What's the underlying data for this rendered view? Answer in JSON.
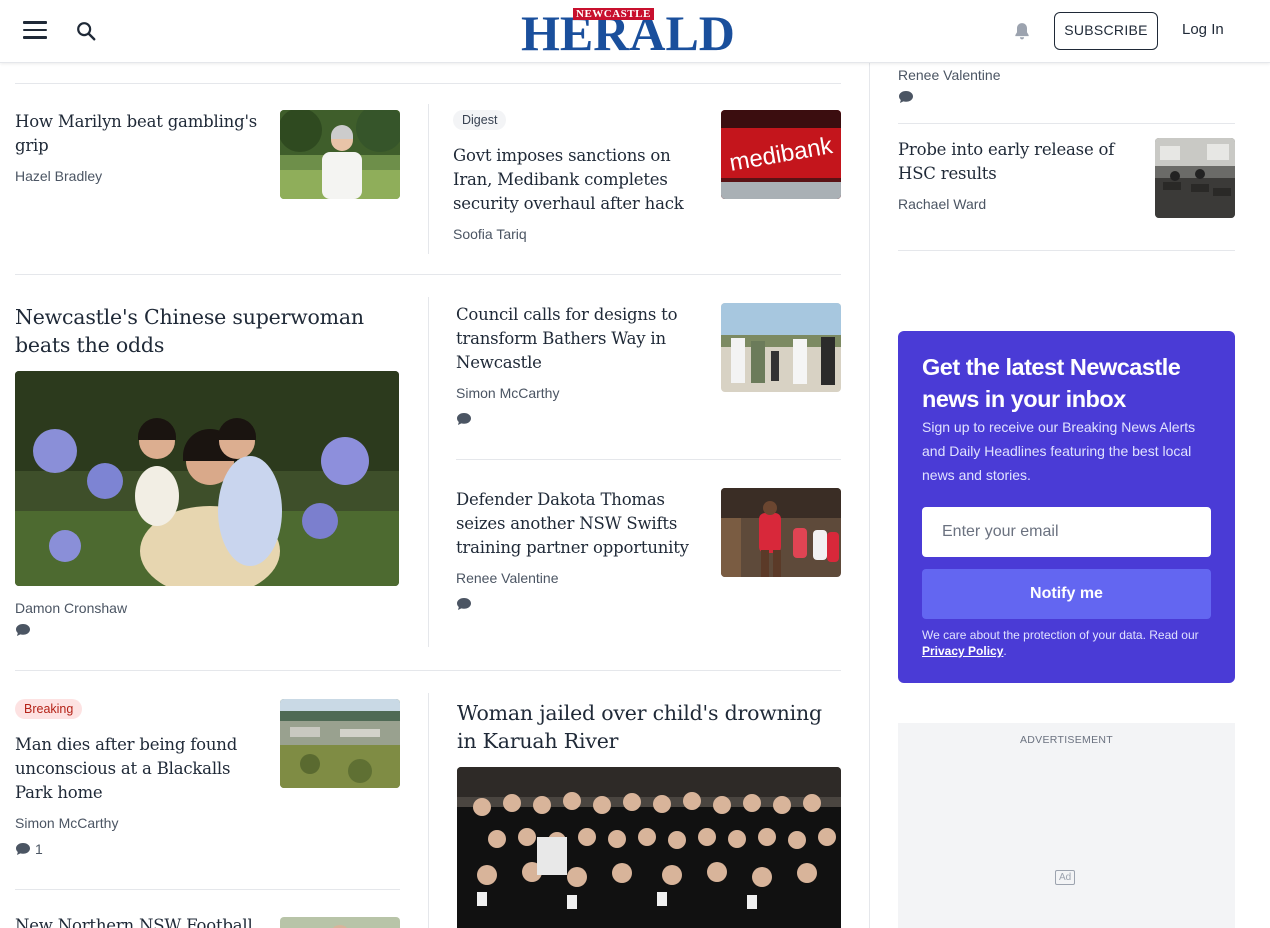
{
  "header": {
    "logo_top": "NEWCASTLE",
    "logo_main": "HERALD",
    "subscribe_label": "SUBSCRIBE",
    "login_label": "Log In"
  },
  "articles": {
    "a1": {
      "headline": "How Marilyn beat gambling's grip",
      "byline": "Hazel Bradley"
    },
    "a2": {
      "tag": "Digest",
      "headline": "Govt imposes sanctions on Iran, Medibank completes security overhaul after hack",
      "byline": "Soofia Tariq"
    },
    "a3": {
      "headline": "Newcastle's Chinese superwoman beats the odds",
      "byline": "Damon Cronshaw"
    },
    "a4": {
      "headline": "Council calls for designs to transform Bathers Way in Newcastle",
      "byline": "Simon McCarthy"
    },
    "a5": {
      "headline": "Defender Dakota Thomas seizes another NSW Swifts training partner opportunity",
      "byline": "Renee Valentine"
    },
    "a6": {
      "tag": "Breaking",
      "headline": "Man dies after being found unconscious at a Blackalls Park home",
      "byline": "Simon McCarthy",
      "comments": "1"
    },
    "a7": {
      "headline": "Woman jailed over child's drowning in Karuah River"
    },
    "a8": {
      "headline": "New Northern NSW Football"
    }
  },
  "sidebar": {
    "s1": {
      "byline": "Renee Valentine"
    },
    "s2": {
      "headline": "Probe into early release of HSC results",
      "byline": "Rachael Ward"
    }
  },
  "newsletter": {
    "title": "Get the latest Newcastle news in your inbox",
    "description": "Sign up to receive our Breaking News Alerts and Daily Headlines featuring the best local news and stories.",
    "email_placeholder": "Enter your email",
    "button_label": "Notify me",
    "privacy_text": "We care about the protection of your data. Read our",
    "privacy_link": "Privacy Policy",
    "privacy_end": "."
  },
  "ad": {
    "label": "ADVERTISEMENT",
    "badge": "Ad"
  },
  "colors": {
    "brand_blue": "#1a4f9c",
    "brand_red": "#c8102e",
    "newsletter_bg": "#4a3bd6",
    "button": "#6366f1",
    "breaking_bg": "#fde2e2",
    "breaking_text": "#b42318",
    "digest_bg": "#f3f4f6"
  },
  "icons": [
    "menu-icon",
    "search-icon",
    "bell-icon",
    "comment-icon"
  ]
}
